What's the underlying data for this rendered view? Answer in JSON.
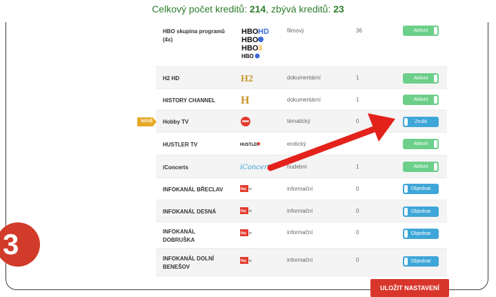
{
  "header": {
    "credits_label": "Celkový počet kreditů: ",
    "credits_total": "214",
    "credits_sep": ", zbývá kreditů: ",
    "credits_left": "23"
  },
  "badge_new": "NOVÉ",
  "step_number": "3",
  "save_button": "ULOŽIT NASTAVENÍ",
  "colors": {
    "active": "#6ccf8a",
    "order": "#3ea6d8",
    "accent": "#d9362b",
    "credits": "#2b7d2b"
  },
  "rows": [
    {
      "name": "HBO skupina programů (4x)",
      "logo": "HBO HD / HBO2 / HBO3 / HBO OD",
      "genre": "filmový",
      "count": "36",
      "button": "Aktivní",
      "state": "active"
    },
    {
      "name": "H2 HD",
      "logo": "H2",
      "genre": "dokumentární",
      "count": "1",
      "button": "Aktivní",
      "state": "active"
    },
    {
      "name": "HISTORY CHANNEL",
      "logo": "H",
      "genre": "dokumentární",
      "count": "1",
      "button": "Aktivní",
      "state": "active"
    },
    {
      "name": "Hobby TV",
      "logo": "Hobby",
      "genre": "tématický",
      "count": "0",
      "button": "Zrušit",
      "state": "cancel"
    },
    {
      "name": "HUSTLER TV",
      "logo": "HUSTLER",
      "genre": "erotický",
      "count": "",
      "button": "Aktivní",
      "state": "active"
    },
    {
      "name": "iConcerts",
      "logo": "iConcerts",
      "genre": "hudební",
      "count": "1",
      "button": "Aktivní",
      "state": "active"
    },
    {
      "name": "INFOKANÁL BŘECLAV",
      "logo": "Nej.cz",
      "genre": "informační",
      "count": "0",
      "button": "Objednat",
      "state": "order"
    },
    {
      "name": "INFOKANÁL DESNÁ",
      "logo": "Nej.cz",
      "genre": "informační",
      "count": "0",
      "button": "Objednat",
      "state": "order"
    },
    {
      "name": "INFOKANÁL DOBRUŠKA",
      "logo": "Nej.cz",
      "genre": "informační",
      "count": "0",
      "button": "Objednat",
      "state": "order"
    },
    {
      "name": "INFOKANÁL DOLNÍ BENEŠOV",
      "logo": "Nej.cz",
      "genre": "informační",
      "count": "0",
      "button": "Objednat",
      "state": "order"
    }
  ]
}
